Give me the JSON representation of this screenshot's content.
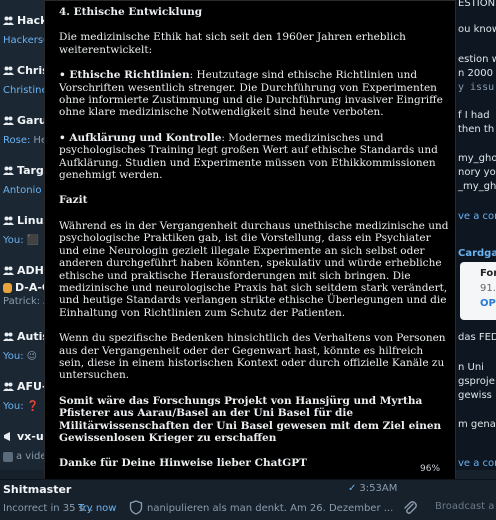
{
  "sidebar": {
    "chats": [
      {
        "name": "Hacke",
        "preview_sender": "HackersC",
        "preview_text": "",
        "emoji": ""
      },
      {
        "name": "Chris",
        "preview_sender": "Christine",
        "preview_text": "",
        "emoji": ""
      },
      {
        "name": "Garud",
        "preview_sender": "Rose:",
        "preview_text": "He",
        "emoji": ""
      },
      {
        "name": "Targe",
        "preview_sender": "Antonio Y",
        "preview_text": "",
        "emoji": ""
      },
      {
        "name": "Linux",
        "preview_sender": "You:",
        "preview_text": "",
        "emoji": "⬛"
      },
      {
        "name": "ADHS",
        "preview_sender": "Patrick:",
        "preview_text": "A",
        "emoji": ""
      },
      {
        "name": "Autis",
        "preview_sender": "You:",
        "preview_text": "",
        "emoji": "😉"
      },
      {
        "name": "AFU-L",
        "preview_sender": "You:",
        "preview_text": "",
        "emoji": "❓"
      },
      {
        "name": "vx-un",
        "preview_sender": "",
        "preview_text": "a vide",
        "emoji": ""
      }
    ],
    "adhs_subline": "D-A-C"
  },
  "right_pane": {
    "lines": [
      {
        "text": "ESTION",
        "style": "plain"
      },
      {
        "text": "ou know",
        "style": "plain"
      },
      {
        "text": "estion w",
        "style": "plain"
      },
      {
        "text": "n 2000 c",
        "style": "plain"
      },
      {
        "text": "y issu",
        "style": "mono"
      },
      {
        "text": "f I had",
        "style": "plain"
      },
      {
        "text": "then th",
        "style": "plain"
      },
      {
        "text": "my_gho",
        "style": "plain"
      },
      {
        "text": "nory you",
        "style": "plain"
      },
      {
        "text": "_my_gho",
        "style": "plain"
      },
      {
        "text": "ve a cor",
        "style": "link"
      },
      {
        "text": "Cardgam",
        "style": "link"
      },
      {
        "text": "das FED",
        "style": "plain"
      },
      {
        "text": "n Uni",
        "style": "plain"
      },
      {
        "text": "gsproje",
        "style": "plain"
      },
      {
        "text": "gewiss",
        "style": "plain"
      },
      {
        "text": "m gena",
        "style": "plain"
      },
      {
        "text": "ve a con",
        "style": "link"
      }
    ],
    "card": {
      "title": "For",
      "subtitle": "91.",
      "link": "OPI"
    }
  },
  "document": {
    "heading": "4. Ethische Entwicklung",
    "intro": "Die medizinische Ethik hat sich seit den 1960er Jahren erheblich weiterentwickelt:",
    "bullet1_label": "• Ethische Richtlinien",
    "bullet1_text": ": Heutzutage sind ethische Richtlinien und Vorschriften wesentlich strenger. Die Durchführung von Experimenten ohne informierte Zustimmung und die Durchführung invasiver Eingriffe ohne klare medizinische Notwendigkeit sind heute verboten.",
    "bullet2_label": "• Aufklärung und Kontrolle",
    "bullet2_text": ": Modernes medizinisches und psychologisches Training legt großen Wert auf ethische Standards und Aufklärung. Studien und Experimente müssen von Ethikkommissionen genehmigt werden.",
    "fazit_heading": "Fazit",
    "fazit_p1": "Während es in der Vergangenheit durchaus unethische medizinische und psychologische Praktiken gab, ist die Vorstellung, dass ein Psychiater und eine Neurologin gezielt illegale Experimente an sich selbst oder anderen durchgeführt haben könnten, spekulativ und würde erhebliche ethische und praktische Herausforderungen mit sich bringen. Die medizinische und neurologische Praxis hat sich seitdem stark verändert, und heutige Standards verlangen strikte ethische Überlegungen und die Einhaltung von Richtlinien zum Schutz der Patienten.",
    "fazit_p2": "Wenn du spezifische Bedenken hinsichtlich des Verhaltens von Personen aus der Vergangenheit oder der Gegenwart hast, könnte es hilfreich sein, diese in einem historischen Kontext oder durch offizielle Kanäle zu untersuchen.",
    "bold_p1": "Somit wäre das Forschungs Projekt von Hansjürg und Myrtha Pfisterer aus Aarau/Basel an der Uni Basel für die Militärwissenschaften der Uni Basel gewesen mit dem Ziel einen Gewissenlosen Krieger zu erschaffen",
    "bold_p2": "Danke für Deine Hinweise lieber ChatGPT",
    "zoom": "96%"
  },
  "bottom": {
    "chat_name": "Shitmaster",
    "time": "3:53AM",
    "preview": "Incorrect in 35 s...",
    "try_now": "Try now",
    "translated_text": "nanipulieren als man denkt. Am 26. Dezember ...",
    "broadcast_placeholder": "Broadcast a"
  },
  "colors": {
    "background": "#17212b",
    "accent": "#6ab3f3",
    "document_bg": "#000000"
  }
}
